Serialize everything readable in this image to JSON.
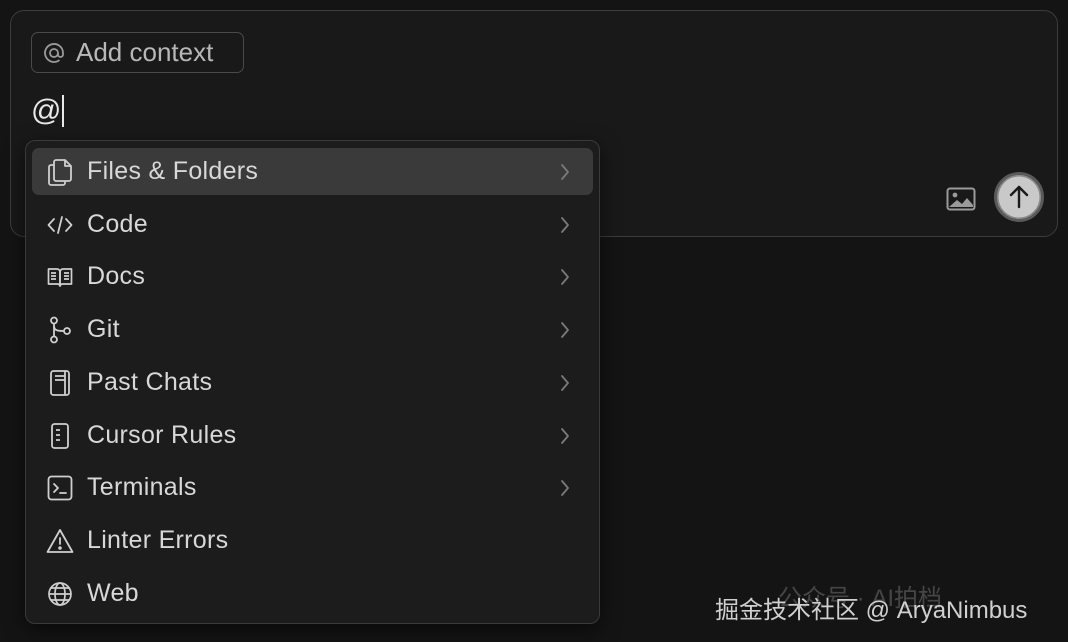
{
  "composer": {
    "context_chip_label": "Add context",
    "prompt_text": "@"
  },
  "menu": {
    "items": [
      {
        "label": "Files & Folders",
        "icon": "files-icon",
        "submenu": true
      },
      {
        "label": "Code",
        "icon": "code-icon",
        "submenu": true
      },
      {
        "label": "Docs",
        "icon": "book-icon",
        "submenu": true
      },
      {
        "label": "Git",
        "icon": "git-branch-icon",
        "submenu": true
      },
      {
        "label": "Past Chats",
        "icon": "notebook-icon",
        "submenu": true
      },
      {
        "label": "Cursor Rules",
        "icon": "rules-icon",
        "submenu": true
      },
      {
        "label": "Terminals",
        "icon": "terminal-icon",
        "submenu": true
      },
      {
        "label": "Linter Errors",
        "icon": "warning-icon",
        "submenu": false
      },
      {
        "label": "Web",
        "icon": "globe-icon",
        "submenu": false
      }
    ],
    "active_index": 0
  },
  "toolbar": {
    "image_icon": "image-icon",
    "send_icon": "arrow-up-icon"
  },
  "watermark": {
    "text": "掘金技术社区 @ AryaNimbus",
    "faint_text": "公众号 · AI拍档"
  },
  "colors": {
    "background": "#141414",
    "panel": "#191919",
    "menu_bg": "#1c1c1c",
    "active_row": "#3a3a3a",
    "text": "#d8d8d8"
  }
}
